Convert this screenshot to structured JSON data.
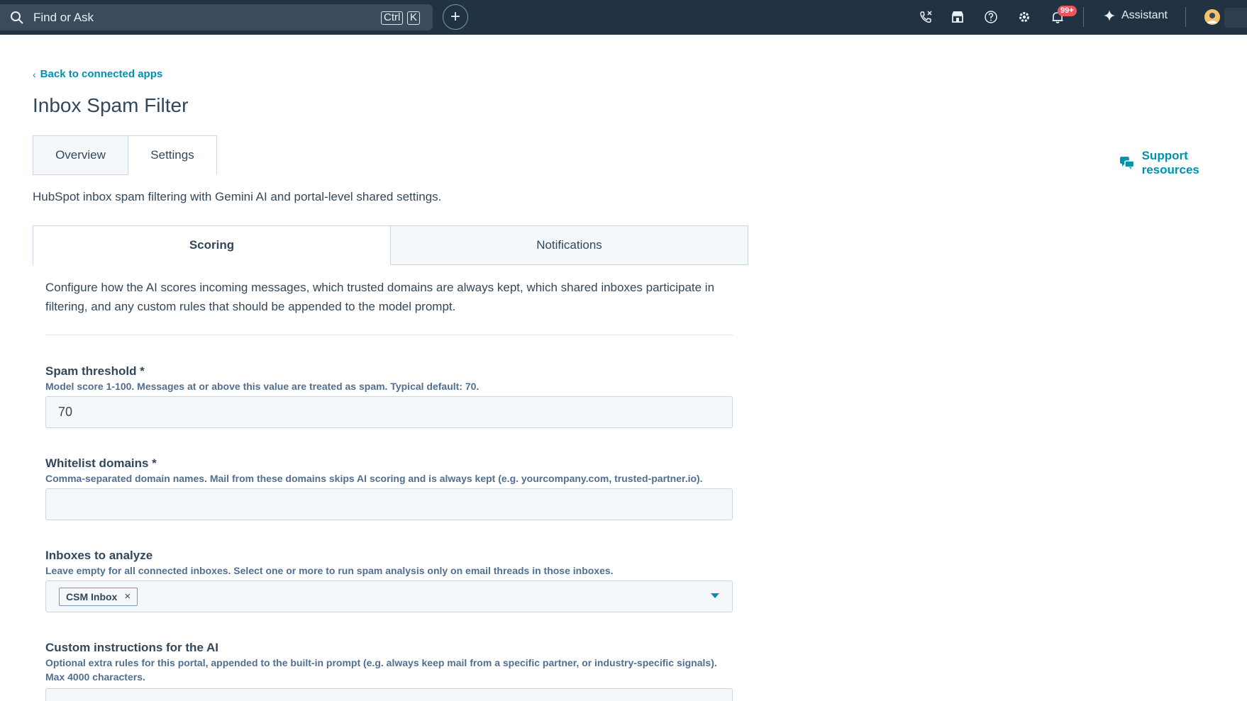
{
  "topbar": {
    "search_placeholder": "Find or Ask",
    "kbd_ctrl": "Ctrl",
    "kbd_k": "K",
    "plus_label": "+",
    "notification_badge": "99+",
    "assistant_label": "Assistant",
    "icons": [
      "search-icon",
      "add-icon",
      "calling-icon",
      "marketplace-icon",
      "help-icon",
      "settings-icon",
      "notifications-icon",
      "assistant-sparkle-icon",
      "avatar"
    ]
  },
  "page": {
    "back_link": "Back to connected apps",
    "title": "Inbox Spam Filter",
    "tabs": [
      {
        "label": "Overview",
        "active": false
      },
      {
        "label": "Settings",
        "active": true
      }
    ],
    "support_link": "Support resources",
    "description": "HubSpot inbox spam filtering with Gemini AI and portal-level shared settings."
  },
  "settings": {
    "subtabs": [
      {
        "label": "Scoring",
        "active": true
      },
      {
        "label": "Notifications",
        "active": false
      }
    ],
    "intro": "Configure how the AI scores incoming messages, which trusted domains are always kept, which shared inboxes participate in filtering, and any custom rules that should be appended to the model prompt.",
    "fields": {
      "spam_threshold": {
        "label": "Spam threshold *",
        "help": "Model score 1-100. Messages at or above this value are treated as spam. Typical default: 70.",
        "value": "70"
      },
      "whitelist_domains": {
        "label": "Whitelist domains *",
        "help": "Comma-separated domain names. Mail from these domains skips AI scoring and is always kept (e.g. yourcompany.com, trusted-partner.io).",
        "value": ""
      },
      "inboxes": {
        "label": "Inboxes to analyze",
        "help": "Leave empty for all connected inboxes. Select one or more to run spam analysis only on email threads in those inboxes.",
        "selected": [
          "CSM Inbox"
        ],
        "chip_remove": "×"
      },
      "custom_instructions": {
        "label": "Custom instructions for the AI",
        "help_line1": "Optional extra rules for this portal, appended to the built-in prompt (e.g. always keep mail from a specific partner, or industry-specific signals).",
        "help_line2": "Max 4000 characters."
      }
    }
  },
  "colors": {
    "nav_bg": "#213343",
    "link": "#0091ae",
    "text": "#33475b",
    "badge": "#f2545b"
  }
}
